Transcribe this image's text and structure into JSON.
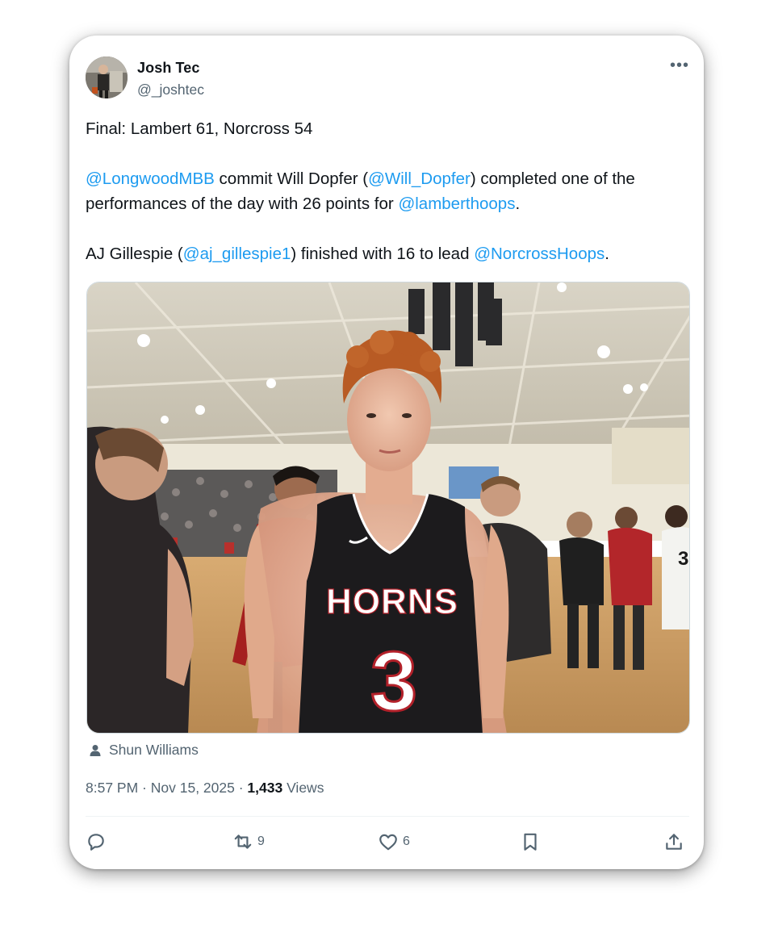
{
  "author": {
    "name": "Josh Tec",
    "handle": "@_joshtec"
  },
  "more_icon": "more-horizontal-icon",
  "post": {
    "line1": "Final: Lambert 61, Norcross 54",
    "p2": {
      "m1": "@LongwoodMBB",
      "t1": " commit Will Dopfer (",
      "m2": "@Will_Dopfer",
      "t2": ") completed one of the performances of the day with 26 points for ",
      "m3": "@lamberthoops",
      "t3": "."
    },
    "p3": {
      "t1": "AJ Gillespie (",
      "m1": "@aj_gillespie1",
      "t2": ") finished with 16 to lead ",
      "m2": "@NorcrossHoops",
      "t3": "."
    }
  },
  "media": {
    "jersey_text": "HORNS",
    "jersey_number": "3",
    "side_jersey_number": "3",
    "credit": "Shun Williams"
  },
  "meta": {
    "time": "8:57 PM",
    "sep1": " · ",
    "date": "Nov 15, 2025",
    "sep2": " · ",
    "views_count": "1,433",
    "views_label": " Views"
  },
  "actions": {
    "reposts": "9",
    "likes": "6"
  },
  "colors": {
    "accent": "#1d9bf0",
    "secondary_text": "#536471",
    "text": "#0f1419",
    "jersey": "#1c1b1d",
    "jersey_trim": "#b3212a"
  }
}
